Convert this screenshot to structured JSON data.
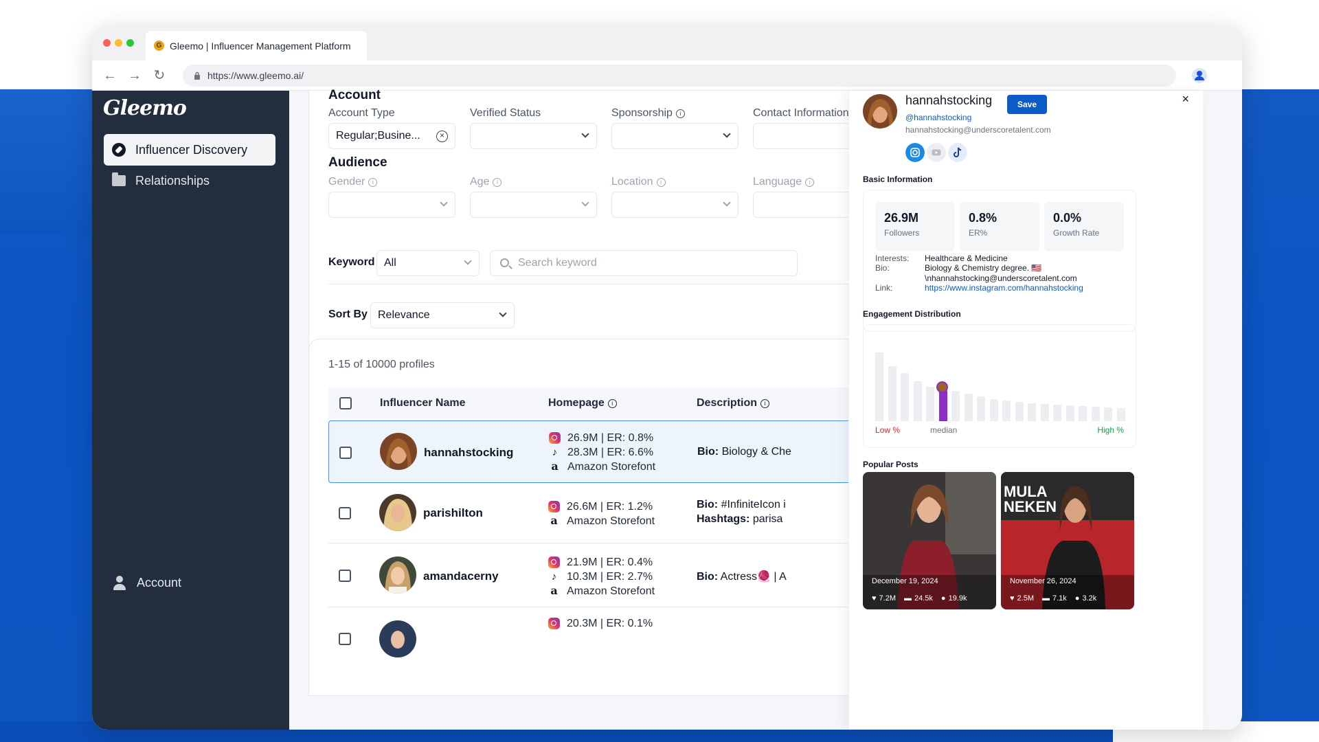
{
  "browser": {
    "tab_title": "Gleemo | Influencer Management Platform",
    "url": "https://www.gleemo.ai/"
  },
  "sidebar": {
    "logo": "Gleemo",
    "items": [
      {
        "label": "Influencer Discovery",
        "icon": "compass-icon",
        "active": true
      },
      {
        "label": "Relationships",
        "icon": "folder-icon",
        "active": false
      }
    ],
    "account_label": "Account"
  },
  "filters": {
    "account_section": "Account",
    "account_type_label": "Account Type",
    "account_type_value": "Regular;Busine...",
    "verified_status_label": "Verified Status",
    "sponsorship_label": "Sponsorship",
    "contact_info_label": "Contact Information",
    "audience_section": "Audience",
    "gender_label": "Gender",
    "age_label": "Age",
    "location_label": "Location",
    "language_label": "Language",
    "keyword_label": "Keyword",
    "keyword_scope": "All",
    "search_placeholder": "Search keyword",
    "sort_label": "Sort By",
    "sort_value": "Relevance"
  },
  "results": {
    "count_text": "1-15 of 10000 profiles",
    "columns": [
      "Influencer Name",
      "Homepage",
      "Description"
    ],
    "rows": [
      {
        "name": "hannahstocking",
        "selected": true,
        "metrics": [
          {
            "platform": "instagram",
            "text": "26.9M | ER: 0.8%"
          },
          {
            "platform": "tiktok",
            "text": "28.3M | ER: 6.6%"
          },
          {
            "platform": "amazon",
            "text": "Amazon Storefont"
          }
        ],
        "desc": [
          {
            "k": "Bio:",
            "v": "Biology & Che"
          }
        ]
      },
      {
        "name": "parishilton",
        "selected": false,
        "metrics": [
          {
            "platform": "instagram",
            "text": "26.6M | ER: 1.2%"
          },
          {
            "platform": "amazon",
            "text": "Amazon Storefont"
          }
        ],
        "desc": [
          {
            "k": "Bio:",
            "v": "#InfiniteIcon i"
          },
          {
            "k": "Hashtags:",
            "v": "parisa"
          }
        ]
      },
      {
        "name": "amandacerny",
        "selected": false,
        "metrics": [
          {
            "platform": "instagram",
            "text": "21.9M | ER: 0.4%"
          },
          {
            "platform": "tiktok",
            "text": "10.3M | ER: 2.7%"
          },
          {
            "platform": "amazon",
            "text": "Amazon Storefont"
          }
        ],
        "desc": [
          {
            "k": "Bio:",
            "v": "Actress🧶 | A"
          }
        ]
      },
      {
        "name": "",
        "selected": false,
        "metrics": [
          {
            "platform": "instagram",
            "text": "20.3M | ER: 0.1%"
          }
        ],
        "desc": []
      }
    ]
  },
  "drawer": {
    "username": "hannahstocking",
    "save_label": "Save",
    "close_label": "×",
    "handle": "@hannahstocking",
    "email": "hannahstocking@underscoretalent.com",
    "basic_info_title": "Basic Information",
    "stats": [
      {
        "value": "26.9M",
        "label": "Followers"
      },
      {
        "value": "0.8%",
        "label": "ER%"
      },
      {
        "value": "0.0%",
        "label": "Growth Rate"
      }
    ],
    "interests_key": "Interests:",
    "interests_value": "Healthcare & Medicine",
    "bio_key": "Bio:",
    "bio_line1": "Biology & Chemistry degree. 🇺🇸",
    "bio_line2": "\\nhannahstocking@underscoretalent.com",
    "link_key": "Link:",
    "link_value": "https://www.instagram.com/hannahstocking",
    "engagement_title": "Engagement Distribution",
    "engagement_low": "Low %",
    "engagement_median": "median",
    "engagement_high": "High %",
    "engagement_bars": [
      100,
      80,
      70,
      58,
      50,
      45,
      44,
      40,
      36,
      32,
      30,
      28,
      26,
      25,
      24,
      23,
      22,
      21,
      20,
      19
    ],
    "engagement_highlight_index": 5,
    "popular_posts_title": "Popular Posts",
    "posts": [
      {
        "date": "December 19, 2024",
        "likes": "7.2M",
        "comments": "24.5k",
        "shares": "19.9k"
      },
      {
        "date": "November 26, 2024",
        "likes": "2.5M",
        "comments": "7.1k",
        "shares": "3.2k"
      }
    ]
  },
  "colors": {
    "accent": "#0b5cc6",
    "sidebar_bg": "#222e3d",
    "highlight_bar": "#8b2fc9",
    "low_label": "#dc2626",
    "high_label": "#16a34a"
  }
}
